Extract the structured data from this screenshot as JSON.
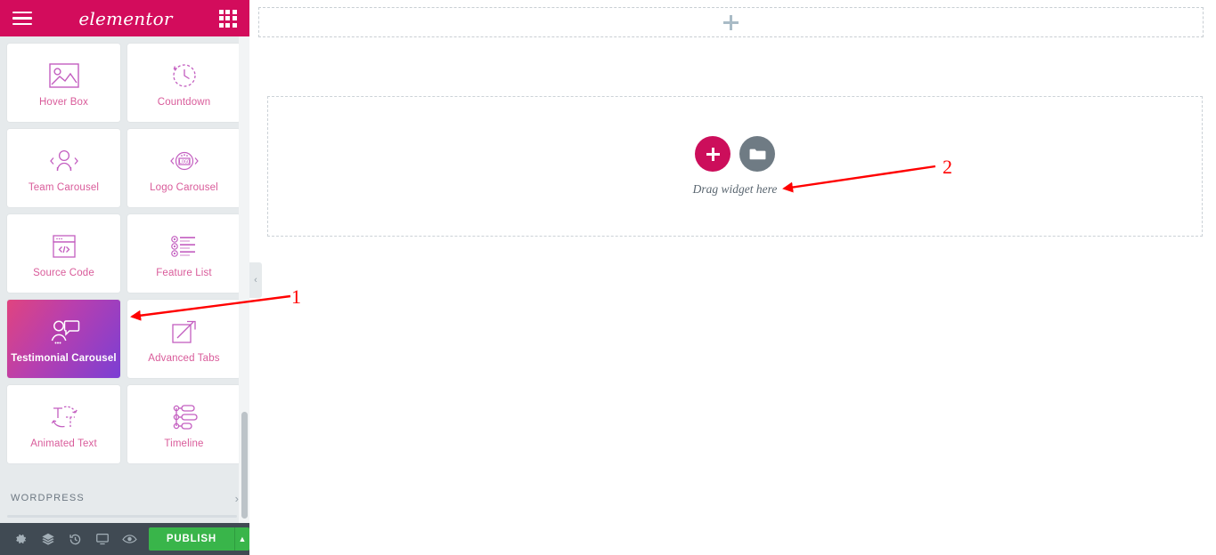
{
  "app": {
    "brand": "elementor"
  },
  "panel": {
    "header": {
      "menu_icon": "hamburger-icon",
      "logo_text": "elementor",
      "grid_icon": "grid-apps-icon"
    },
    "widgets": [
      {
        "label": "Hover Box",
        "icon": "image-placeholder-icon",
        "active": false
      },
      {
        "label": "Countdown",
        "icon": "clock-countdown-icon",
        "active": false
      },
      {
        "label": "Team Carousel",
        "icon": "person-carousel-icon",
        "active": false
      },
      {
        "label": "Logo Carousel",
        "icon": "logo-carousel-icon",
        "active": false
      },
      {
        "label": "Source Code",
        "icon": "code-window-icon",
        "active": false
      },
      {
        "label": "Feature List",
        "icon": "feature-list-icon",
        "active": false
      },
      {
        "label": "Testimonial Carousel",
        "icon": "testimonial-icon",
        "active": true
      },
      {
        "label": "Advanced Tabs",
        "icon": "expand-tabs-icon",
        "active": false
      },
      {
        "label": "Animated Text",
        "icon": "animated-text-icon",
        "active": false
      },
      {
        "label": "Timeline",
        "icon": "timeline-icon",
        "active": false
      }
    ],
    "category": {
      "title": "WORDPRESS",
      "arrow": "chevron-right-icon"
    },
    "collapse_tab": {
      "icon": "chevron-left-icon"
    },
    "bottom_bar": {
      "icons": [
        {
          "name": "settings-gear-icon"
        },
        {
          "name": "navigator-layers-icon"
        },
        {
          "name": "history-revisions-icon"
        },
        {
          "name": "responsive-mode-icon"
        },
        {
          "name": "preview-eye-icon"
        }
      ],
      "publish_label": "PUBLISH",
      "publish_caret": "caret-up-icon"
    }
  },
  "canvas": {
    "add_section_top": {
      "icon": "plus-icon"
    },
    "drop_area": {
      "add_widget_icon": "plus-icon",
      "add_template_icon": "folder-icon",
      "label": "Drag widget here"
    }
  },
  "annotations": [
    {
      "number": "1",
      "target": "testimonial-carousel-widget"
    },
    {
      "number": "2",
      "target": "drag-widget-here-label"
    }
  ],
  "colors": {
    "brand_pink": "#d30c5c",
    "accent_pink": "#cc0e5b",
    "panel_bg": "#e6eaec",
    "bottom_bar": "#404a53",
    "publish_green": "#39b54a",
    "widget_label": "#d95b9a",
    "annotation_red": "#ff0000",
    "gradient_start": "#e0447f",
    "gradient_end": "#7b3fd4"
  }
}
